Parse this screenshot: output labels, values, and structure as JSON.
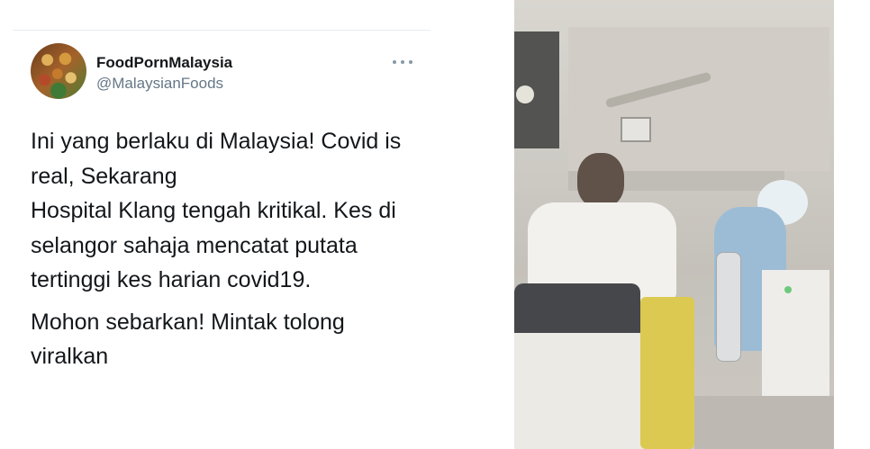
{
  "tweet": {
    "display_name": "FoodPornMalaysia",
    "handle": "@MalaysianFoods",
    "more_label": "...",
    "paragraphs": [
      "Ini yang berlaku di Malaysia! Covid is\nreal, Sekarang\nHospital Klang tengah kritikal. Kes di\nselangor sahaja mencatat putata\ntertinggi kes harian covid19.",
      "Mohon sebarkan! Mintak tolong\nviralkan"
    ]
  },
  "media": {
    "icon": "video-still"
  }
}
